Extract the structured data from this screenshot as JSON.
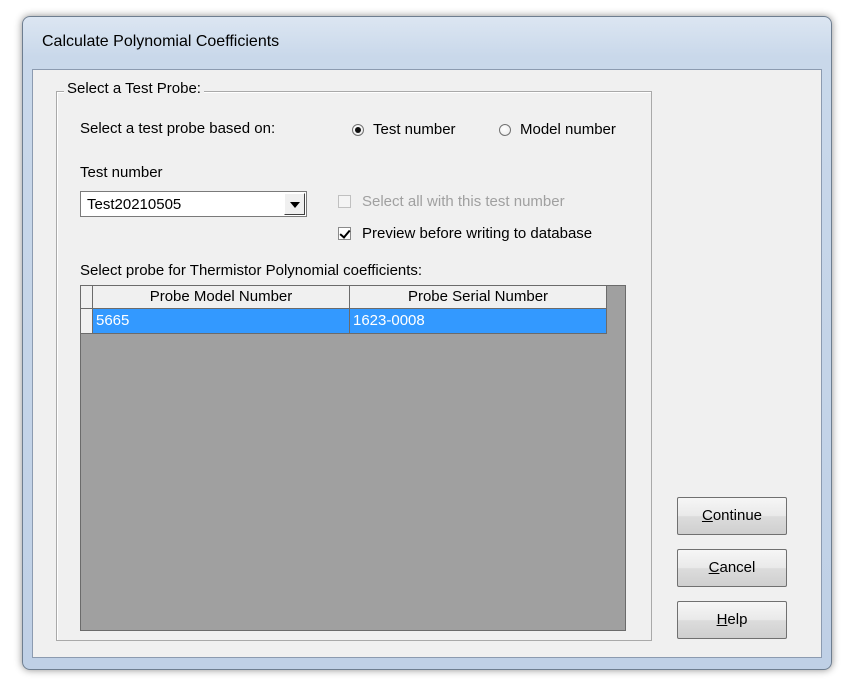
{
  "window": {
    "title": "Calculate Polynomial Coefficients"
  },
  "group": {
    "legend": "Select a Test Probe:"
  },
  "selection": {
    "based_on_label": "Select a test probe based on:",
    "options": [
      {
        "label": "Test number",
        "checked": true
      },
      {
        "label": "Model number",
        "checked": false
      }
    ]
  },
  "test_number": {
    "label": "Test number",
    "selected": "Test20210505"
  },
  "checkboxes": {
    "select_all": {
      "label": "Select all with this test number",
      "checked": false,
      "enabled": false
    },
    "preview": {
      "label": "Preview before writing to database",
      "checked": true,
      "enabled": true
    }
  },
  "probe_grid": {
    "label": "Select probe for Thermistor Polynomial coefficients:",
    "columns": [
      "Probe Model Number",
      "Probe Serial Number"
    ],
    "rows": [
      [
        "5665",
        "1623-0008"
      ]
    ],
    "selected_row": 0
  },
  "buttons": {
    "continue": {
      "accel": "C",
      "rest": "ontinue"
    },
    "cancel": {
      "accel": "C",
      "rest": "ancel"
    },
    "help": {
      "accel": "H",
      "rest": "elp"
    }
  },
  "colors": {
    "selection": "#3399ff",
    "grid_background": "#a0a0a0",
    "dialog_face": "#f0f0f0"
  }
}
